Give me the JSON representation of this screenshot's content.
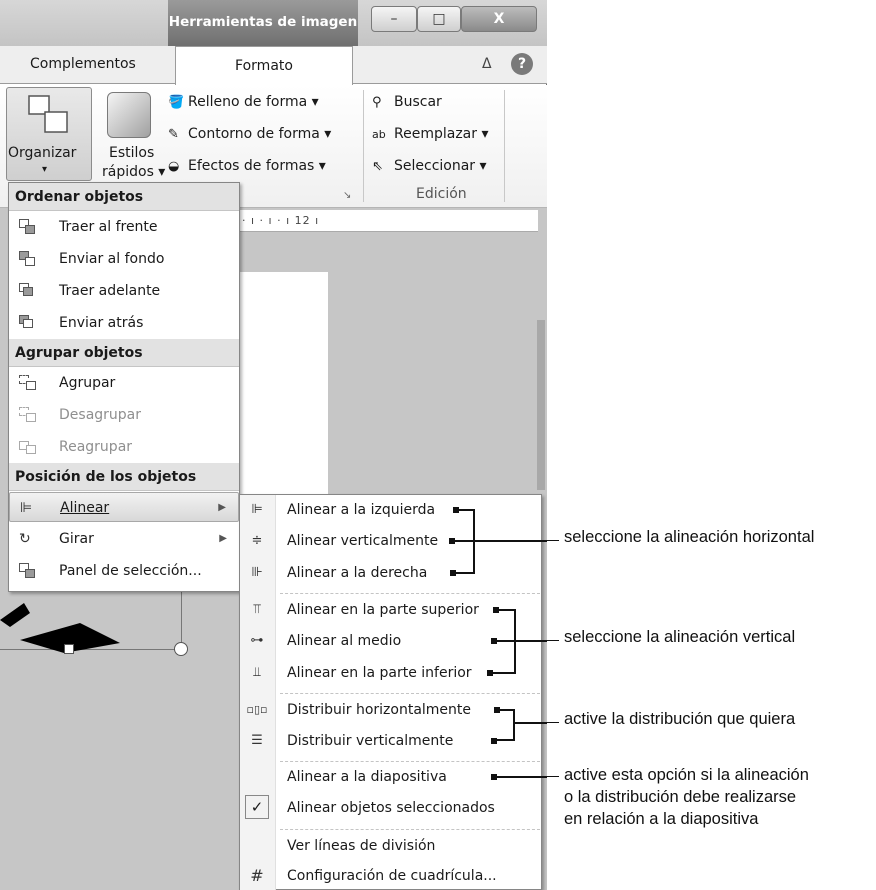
{
  "window": {
    "contextual_tab": "Herramientas de imagen",
    "controls": {
      "minimize": "–",
      "maximize": "□",
      "close": "X"
    }
  },
  "tabs": {
    "complementos": "Complementos",
    "formato": "Formato",
    "collapse": "ᐃ",
    "help": "?"
  },
  "ribbon": {
    "organizar": "Organizar",
    "organizar_arrow": "▾",
    "estilos_line1": "Estilos",
    "estilos_line2": "rápidos ▾",
    "shape_fill": "Relleno de forma ▾",
    "shape_outline": "Contorno de forma ▾",
    "shape_effects": "Efectos de formas ▾",
    "find": "Buscar",
    "replace": "Reemplazar ▾",
    "select": "Seleccionar ▾",
    "editing_group": "Edición",
    "dialog_launcher": "↘"
  },
  "ruler": {
    "text": "· ı · ı · ı 12 ı"
  },
  "menu1": {
    "header_order": "Ordenar objetos",
    "bring_front": "Traer al frente",
    "send_back": "Enviar al fondo",
    "bring_forward": "Traer adelante",
    "send_backward": "Enviar atrás",
    "header_group": "Agrupar objetos",
    "group": "Agrupar",
    "ungroup": "Desagrupar",
    "regroup": "Reagrupar",
    "header_position": "Posición de los objetos",
    "align": "Alinear",
    "rotate": "Girar",
    "selection_pane": "Panel de selección...",
    "arrow": "▶"
  },
  "menu2": {
    "align_left": "Alinear a la izquierda",
    "align_center": "Alinear verticalmente",
    "align_right": "Alinear a la derecha",
    "align_top": "Alinear en la parte superior",
    "align_middle": "Alinear al medio",
    "align_bottom": "Alinear en la parte inferior",
    "distribute_h": "Distribuir horizontalmente",
    "distribute_v": "Distribuir verticalmente",
    "align_slide": "Alinear a la diapositiva",
    "align_selected": "Alinear objetos seleccionados",
    "view_gridlines": "Ver líneas de división",
    "grid_settings": "Configuración de cuadrícula...",
    "check": "✓"
  },
  "annotations": {
    "horizontal": "seleccione la alineación horizontal",
    "vertical": "seleccione la alineación vertical",
    "distribution": "active la distribución que quiera",
    "slide_line1": "active esta opción si la alineación",
    "slide_line2": "o la distribución debe realizarse",
    "slide_line3": "en relación a la diapositiva"
  }
}
